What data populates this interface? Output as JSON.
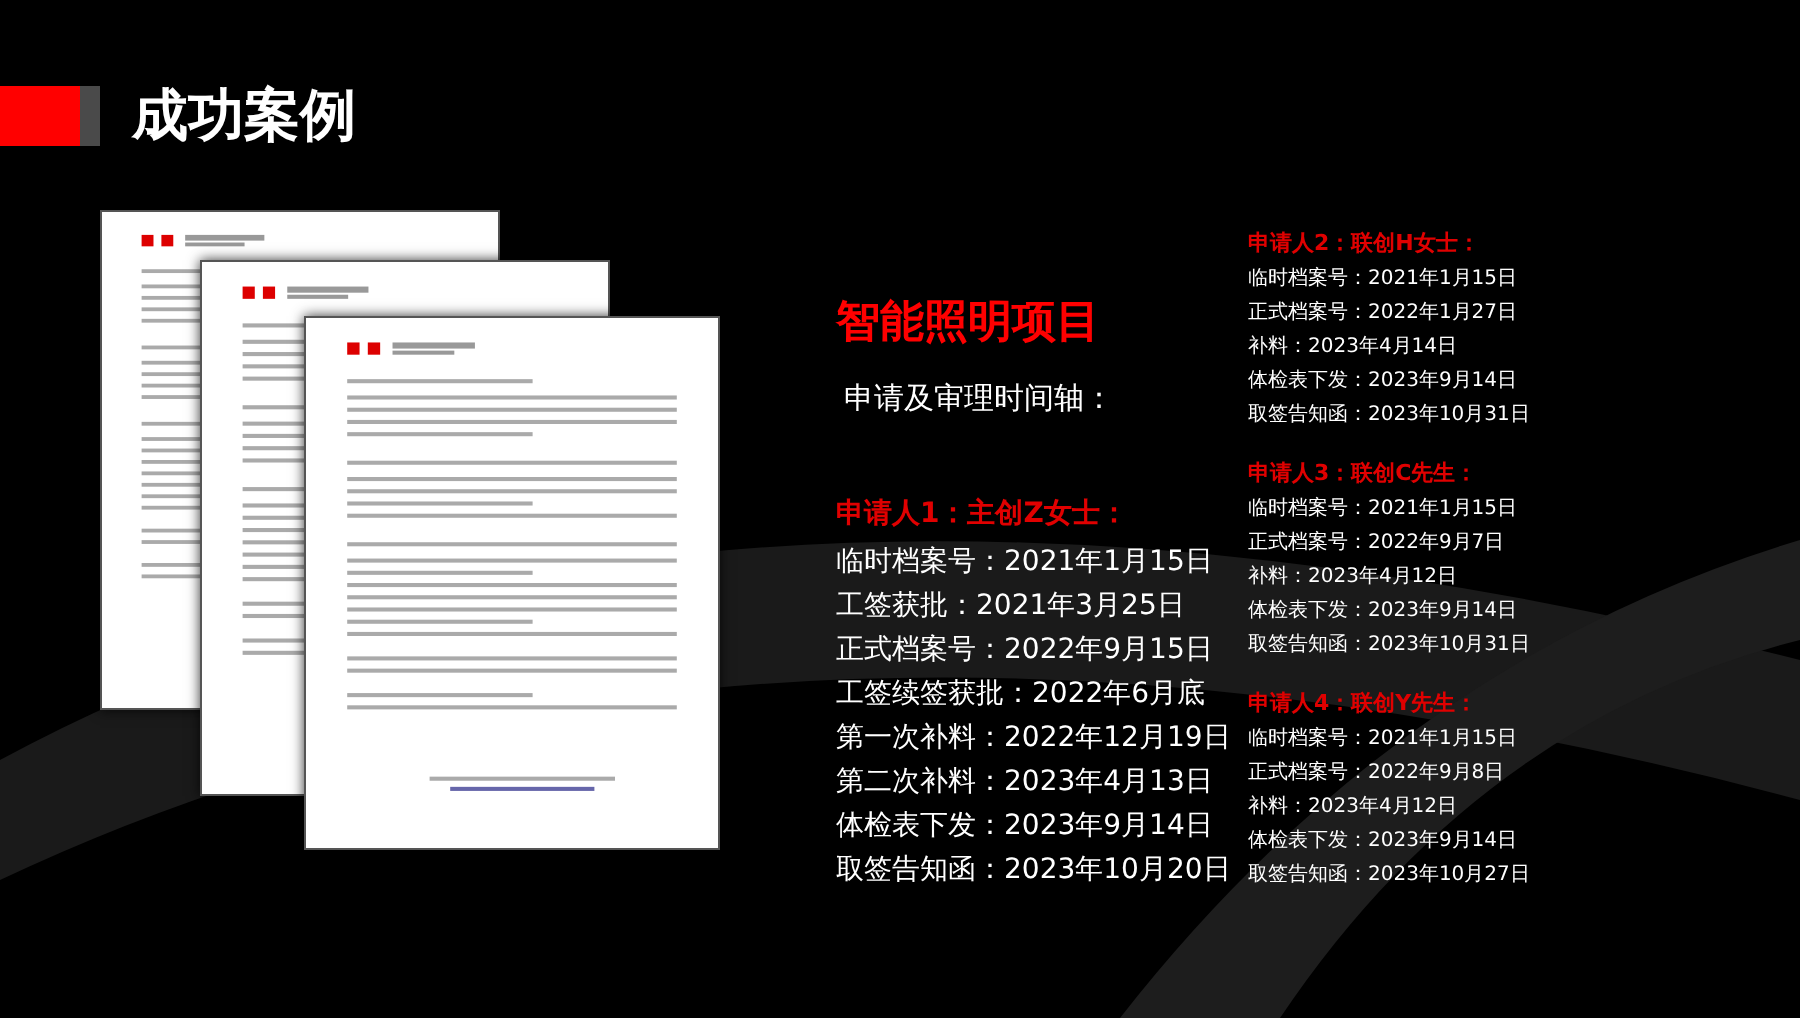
{
  "title": "成功案例",
  "project": {
    "name": "智能照明项目",
    "subtitle": "申请及审理时间轴："
  },
  "main_applicant": {
    "header": "申请人1：主创Z女士：",
    "entries": [
      "临时档案号：2021年1月15日",
      "工签获批：2021年3月25日",
      "正式档案号：2022年9月15日",
      "工签续签获批：2022年6月底",
      "第一次补料：2022年12月19日",
      "第二次补料：2023年4月13日",
      "体检表下发：2023年9月14日",
      "取签告知函：2023年10月20日"
    ]
  },
  "other_applicants": [
    {
      "header": "申请人2：联创H女士：",
      "entries": [
        "临时档案号：2021年1月15日",
        "正式档案号：2022年1月27日",
        "补料：2023年4月14日",
        "体检表下发：2023年9月14日",
        "取签告知函：2023年10月31日"
      ]
    },
    {
      "header": "申请人3：联创C先生：",
      "entries": [
        "临时档案号：2021年1月15日",
        "正式档案号：2022年9月7日",
        "补料：2023年4月12日",
        "体检表下发：2023年9月14日",
        "取签告知函：2023年10月31日"
      ]
    },
    {
      "header": "申请人4：联创Y先生：",
      "entries": [
        "临时档案号：2021年1月15日",
        "正式档案号：2022年9月8日",
        "补料：2023年4月12日",
        "体检表下发：2023年9月14日",
        "取签告知函：2023年10月27日"
      ]
    }
  ]
}
